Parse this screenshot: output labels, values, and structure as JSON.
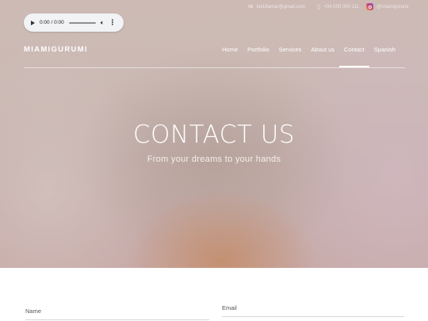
{
  "topbar": {
    "email": "iuli18amar@gmail.com",
    "phone": "+34 000 000 111",
    "instagram": "@miamigurumi",
    "email_icon": "email-icon",
    "phone_icon": "phone-icon",
    "instagram_icon": "instagram-icon"
  },
  "audio": {
    "time": "0:00 / 0:00",
    "play_icon": "play-icon",
    "volume_icon": "volume-icon",
    "more_icon": "more-options-icon"
  },
  "brand": "MIAMIGURUMI",
  "nav": {
    "items": [
      "Home",
      "Portfolio",
      "Services",
      "About us",
      "Contact",
      "Spanish"
    ],
    "active": "Contact"
  },
  "hero": {
    "title": "CONTACT US",
    "subtitle": "From your dreams to your hands"
  },
  "form": {
    "name_placeholder": "Name",
    "email_placeholder": "Email"
  }
}
